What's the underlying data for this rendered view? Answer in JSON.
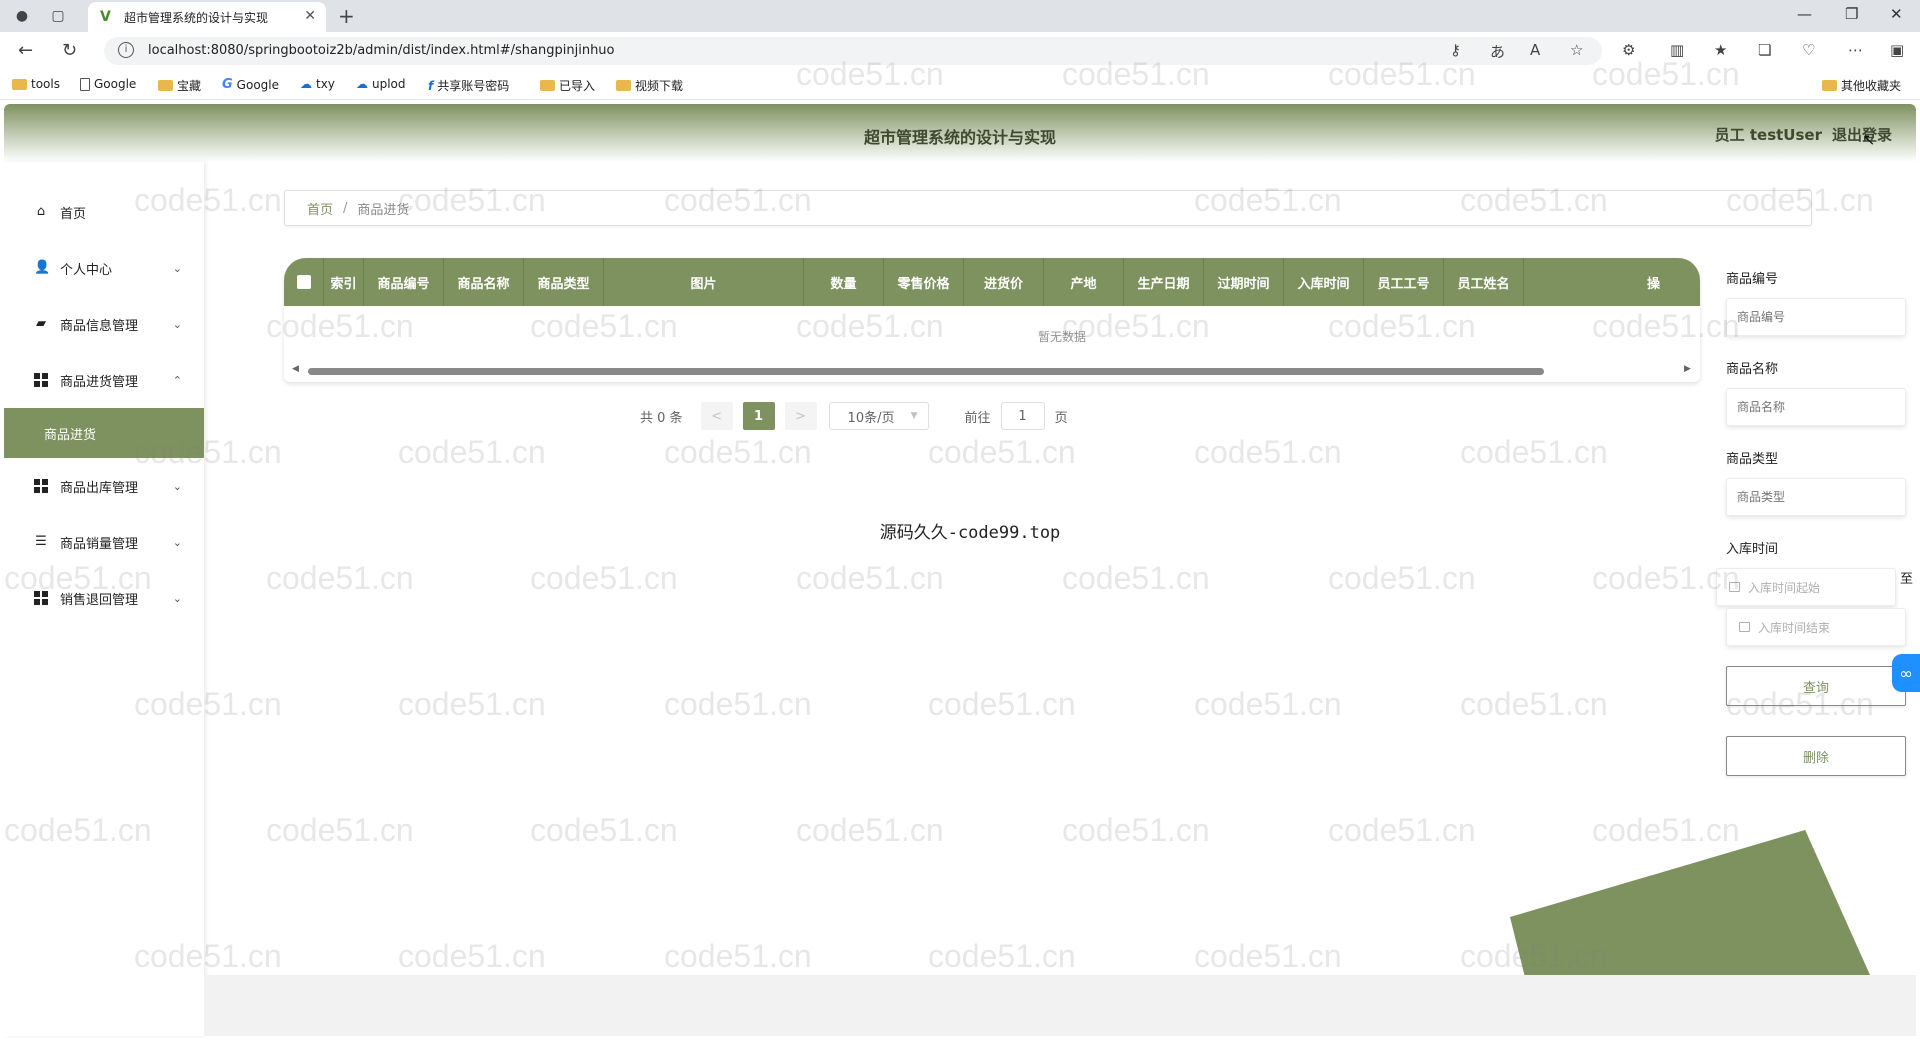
{
  "browser": {
    "tab_title": "超市管理系统的设计与实现",
    "url": "localhost:8080/springbootoiz2b/admin/dist/index.html#/shangpinjinhuo",
    "bookmarks": [
      "tools",
      "Google",
      "宝藏",
      "Google",
      "txy",
      "uplod",
      "共享账号密码",
      "已导入",
      "视频下载"
    ],
    "other_bookmarks": "其他收藏夹"
  },
  "header": {
    "title": "超市管理系统的设计与实现",
    "user_label": "员工 testUser",
    "logout_label": "退出登录"
  },
  "sidebar": {
    "items": [
      {
        "label": "首页",
        "icon": "home-icon"
      },
      {
        "label": "个人中心",
        "icon": "user-icon"
      },
      {
        "label": "商品信息管理",
        "icon": "chart-icon"
      },
      {
        "label": "商品进货管理",
        "icon": "grid-icon"
      },
      {
        "label": "商品出库管理",
        "icon": "grid-icon"
      },
      {
        "label": "商品销量管理",
        "icon": "sliders-icon"
      },
      {
        "label": "销售退回管理",
        "icon": "grid-icon"
      }
    ],
    "active_sub": "商品进货"
  },
  "breadcrumb": {
    "home": "首页",
    "separator": "/",
    "current": "商品进货"
  },
  "table": {
    "columns": [
      "索引",
      "商品编号",
      "商品名称",
      "商品类型",
      "图片",
      "数量",
      "零售价格",
      "进货价",
      "产地",
      "生产日期",
      "过期时间",
      "入库时间",
      "员工工号",
      "员工姓名",
      "操"
    ],
    "empty_text": "暂无数据"
  },
  "pagination": {
    "total": "共 0 条",
    "prev": "<",
    "current_page": "1",
    "next": ">",
    "page_size": "10条/页",
    "goto_label": "前往",
    "goto_value": "1",
    "page_suffix": "页"
  },
  "footer_text": "源码久久-code99.top",
  "search_panel": {
    "product_code_label": "商品编号",
    "product_code_placeholder": "商品编号",
    "product_name_label": "商品名称",
    "product_name_placeholder": "商品名称",
    "product_type_label": "商品类型",
    "product_type_placeholder": "商品类型",
    "stock_time_label": "入库时间",
    "stock_time_start": "入库时间起始",
    "range_separator": "至",
    "stock_time_end": "入库时间结束",
    "query_button": "查询",
    "delete_button": "删除"
  },
  "watermark_text": "code51.cn",
  "colors": {
    "accent": "#7e9260",
    "header_text": "#3d4a2e"
  }
}
